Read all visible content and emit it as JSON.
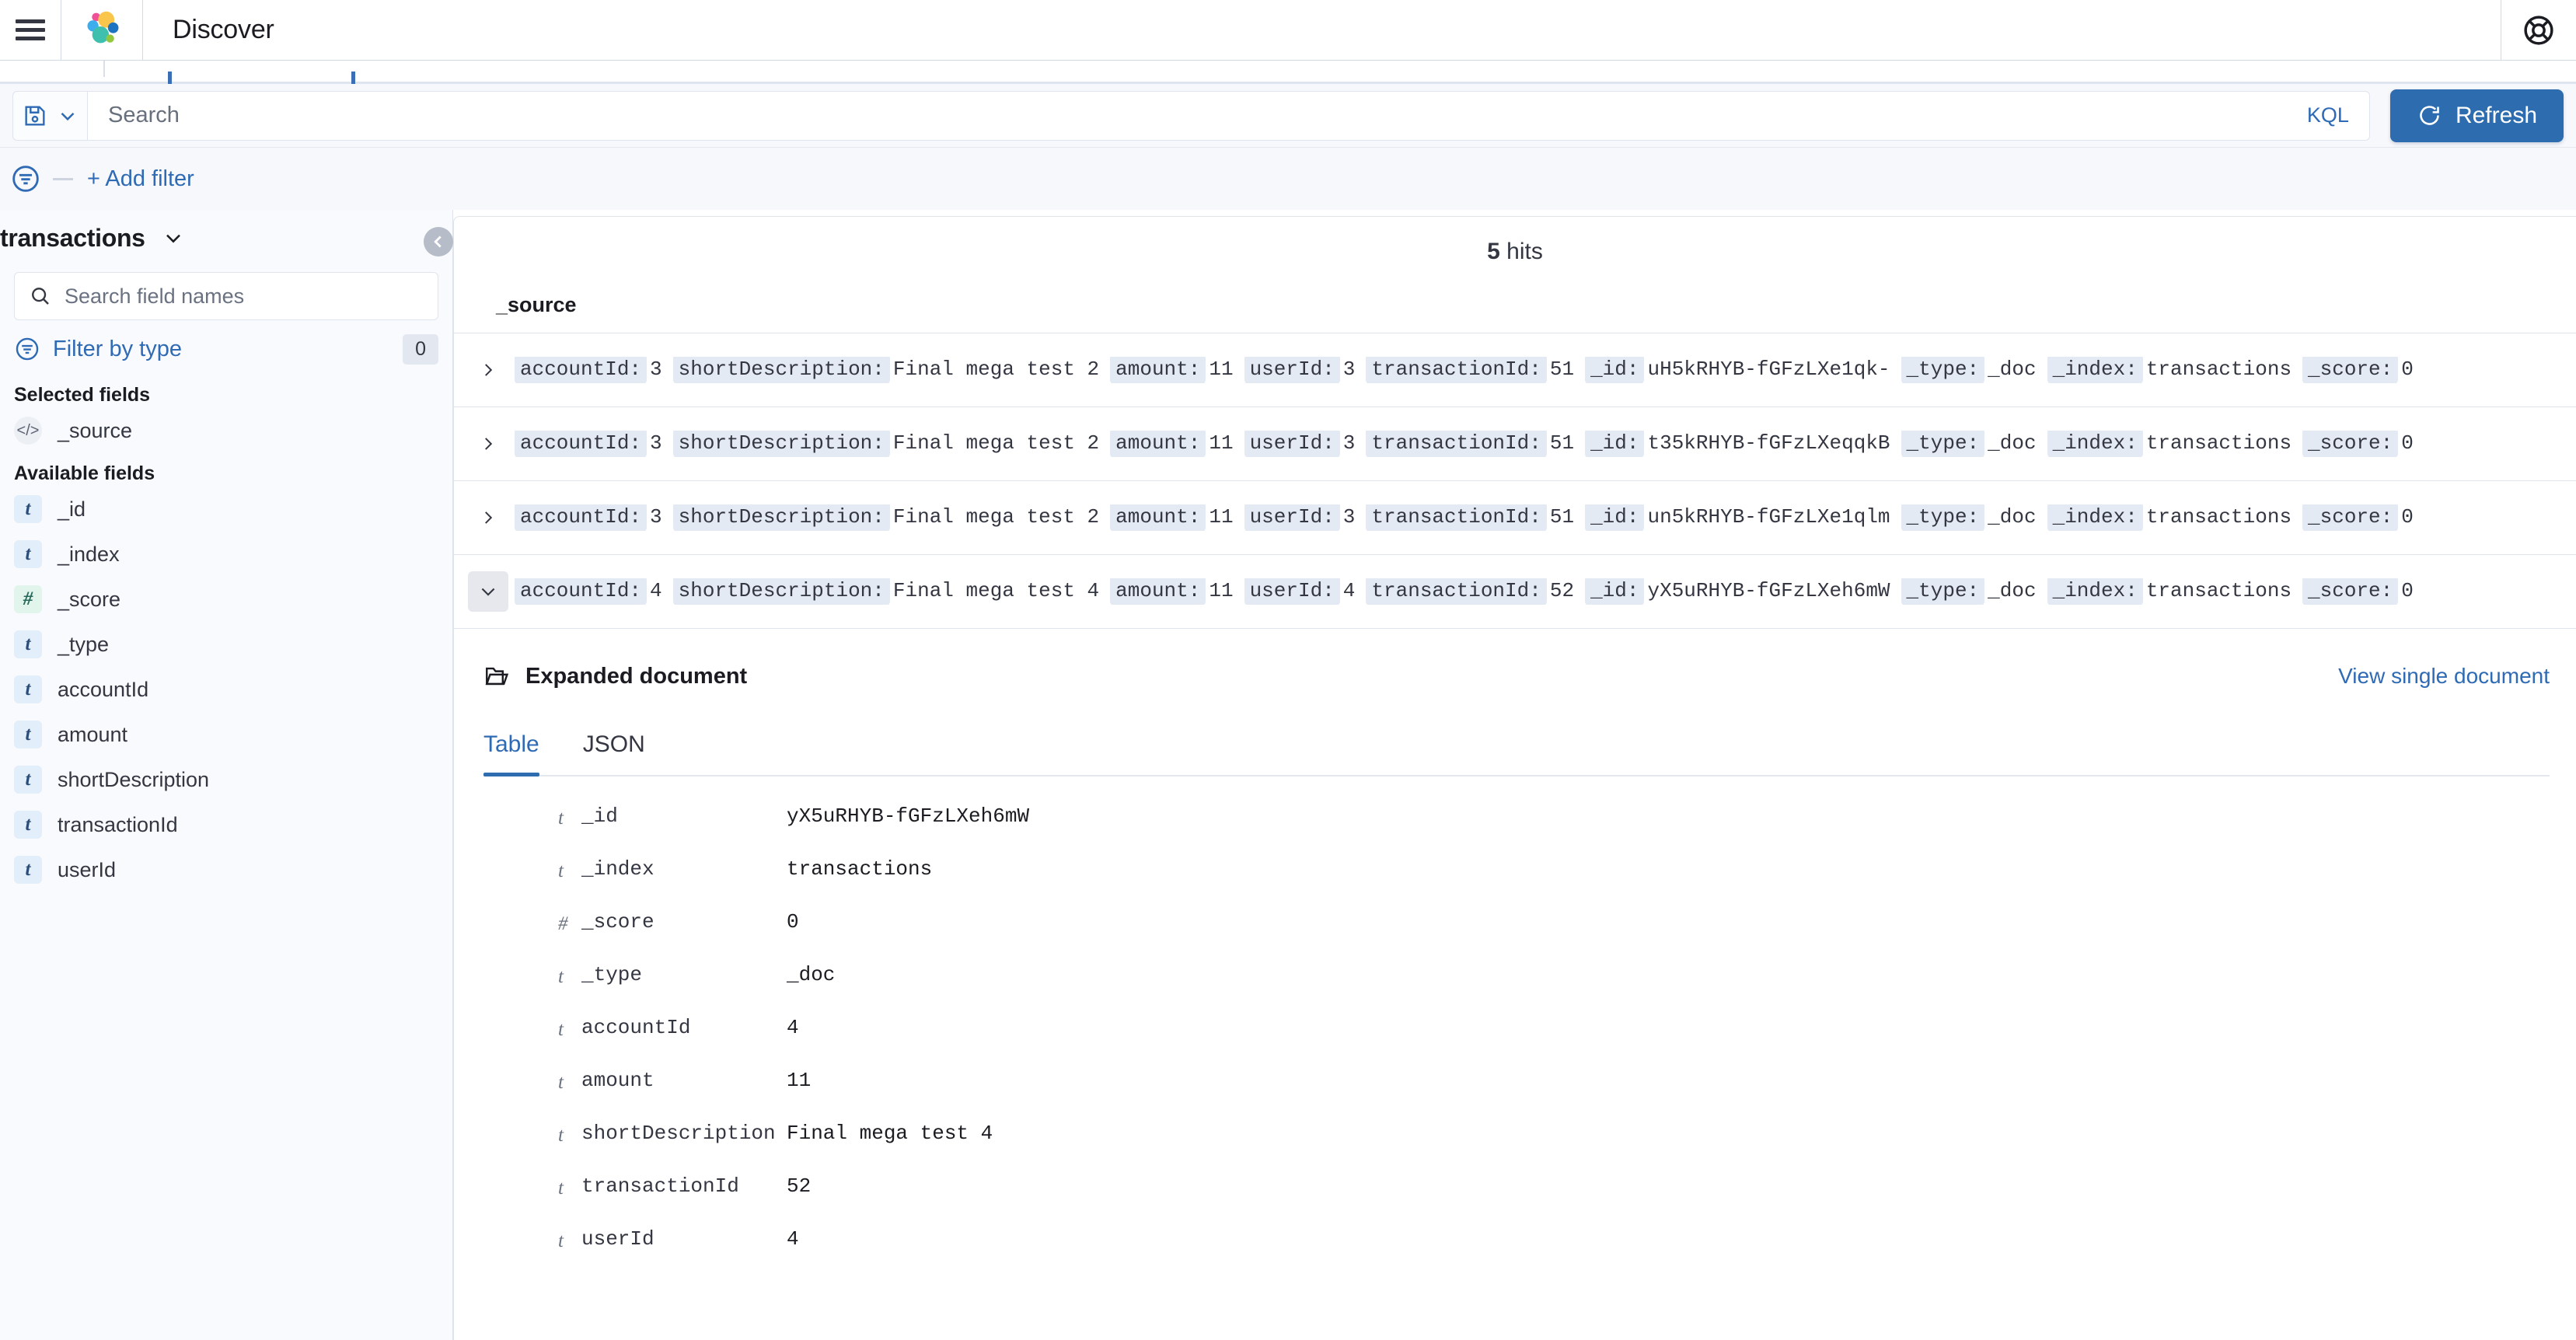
{
  "topnav": {
    "menu_icon": "hamburger-menu-icon",
    "logo_icon": "elastic-logo-icon",
    "title": "Discover",
    "help_icon": "help-lifebuoy-icon"
  },
  "querybar": {
    "saved_query_icon": "save-floppy-icon",
    "saved_query_chevron": "chevron-down-icon",
    "search_value": "",
    "search_placeholder": "Search",
    "language_label": "KQL",
    "refresh_icon": "refresh-icon",
    "refresh_label": "Refresh"
  },
  "filterbar": {
    "filter_icon": "filter-funnel-icon",
    "add_filter_label": "+ Add filter"
  },
  "sidebar": {
    "index_pattern": "transactions",
    "index_pattern_chevron": "chevron-down-icon",
    "field_search_value": "",
    "field_search_placeholder": "Search field names",
    "search_icon": "search-icon",
    "filter_by_type_icon": "filter-funnel-icon",
    "filter_by_type_label": "Filter by type",
    "filter_by_type_count": "0",
    "selected_fields_title": "Selected fields",
    "selected_fields": [
      {
        "name": "_source",
        "type": "source",
        "type_glyph": "</>"
      }
    ],
    "available_fields_title": "Available fields",
    "available_fields": [
      {
        "name": "_id",
        "type": "string",
        "type_glyph": "t"
      },
      {
        "name": "_index",
        "type": "string",
        "type_glyph": "t"
      },
      {
        "name": "_score",
        "type": "number",
        "type_glyph": "#"
      },
      {
        "name": "_type",
        "type": "string",
        "type_glyph": "t"
      },
      {
        "name": "accountId",
        "type": "string",
        "type_glyph": "t"
      },
      {
        "name": "amount",
        "type": "string",
        "type_glyph": "t"
      },
      {
        "name": "shortDescription",
        "type": "string",
        "type_glyph": "t"
      },
      {
        "name": "transactionId",
        "type": "string",
        "type_glyph": "t"
      },
      {
        "name": "userId",
        "type": "string",
        "type_glyph": "t"
      }
    ]
  },
  "main": {
    "collapse_icon": "chevron-left-icon",
    "hits_count": "5",
    "hits_label": "hits",
    "source_column_header": "_source",
    "rows": [
      {
        "expanded": false,
        "caret_icon": "chevron-right-icon",
        "pairs": [
          {
            "key": "accountId:",
            "value": "3"
          },
          {
            "key": "shortDescription:",
            "value": "Final mega test 2"
          },
          {
            "key": "amount:",
            "value": "11"
          },
          {
            "key": "userId:",
            "value": "3"
          },
          {
            "key": "transactionId:",
            "value": "51"
          },
          {
            "key": "_id:",
            "value": "uH5kRHYB-fGFzLXe1qk-"
          },
          {
            "key": "_type:",
            "value": "_doc"
          },
          {
            "key": "_index:",
            "value": "transactions"
          },
          {
            "key": "_score:",
            "value": "0"
          }
        ]
      },
      {
        "expanded": false,
        "caret_icon": "chevron-right-icon",
        "pairs": [
          {
            "key": "accountId:",
            "value": "3"
          },
          {
            "key": "shortDescription:",
            "value": "Final mega test 2"
          },
          {
            "key": "amount:",
            "value": "11"
          },
          {
            "key": "userId:",
            "value": "3"
          },
          {
            "key": "transactionId:",
            "value": "51"
          },
          {
            "key": "_id:",
            "value": "t35kRHYB-fGFzLXeqqkB"
          },
          {
            "key": "_type:",
            "value": "_doc"
          },
          {
            "key": "_index:",
            "value": "transactions"
          },
          {
            "key": "_score:",
            "value": "0"
          }
        ]
      },
      {
        "expanded": false,
        "caret_icon": "chevron-right-icon",
        "pairs": [
          {
            "key": "accountId:",
            "value": "3"
          },
          {
            "key": "shortDescription:",
            "value": "Final mega test 2"
          },
          {
            "key": "amount:",
            "value": "11"
          },
          {
            "key": "userId:",
            "value": "3"
          },
          {
            "key": "transactionId:",
            "value": "51"
          },
          {
            "key": "_id:",
            "value": "un5kRHYB-fGFzLXe1qlm"
          },
          {
            "key": "_type:",
            "value": "_doc"
          },
          {
            "key": "_index:",
            "value": "transactions"
          },
          {
            "key": "_score:",
            "value": "0"
          }
        ]
      },
      {
        "expanded": true,
        "caret_icon": "chevron-down-icon",
        "pairs": [
          {
            "key": "accountId:",
            "value": "4"
          },
          {
            "key": "shortDescription:",
            "value": "Final mega test 4"
          },
          {
            "key": "amount:",
            "value": "11"
          },
          {
            "key": "userId:",
            "value": "4"
          },
          {
            "key": "transactionId:",
            "value": "52"
          },
          {
            "key": "_id:",
            "value": "yX5uRHYB-fGFzLXeh6mW"
          },
          {
            "key": "_type:",
            "value": "_doc"
          },
          {
            "key": "_index:",
            "value": "transactions"
          },
          {
            "key": "_score:",
            "value": "0"
          }
        ]
      }
    ]
  },
  "expanded_document": {
    "folder_icon": "folder-open-icon",
    "title": "Expanded document",
    "view_single_label": "View single document",
    "tabs": [
      {
        "label": "Table",
        "active": true
      },
      {
        "label": "JSON",
        "active": false
      }
    ],
    "fields": [
      {
        "type_glyph": "t",
        "name": "_id",
        "value": "yX5uRHYB-fGFzLXeh6mW"
      },
      {
        "type_glyph": "t",
        "name": "_index",
        "value": "transactions"
      },
      {
        "type_glyph": "#",
        "name": "_score",
        "value": "0"
      },
      {
        "type_glyph": "t",
        "name": "_type",
        "value": "_doc"
      },
      {
        "type_glyph": "t",
        "name": "accountId",
        "value": "4"
      },
      {
        "type_glyph": "t",
        "name": "amount",
        "value": "11"
      },
      {
        "type_glyph": "t",
        "name": "shortDescription",
        "value": "Final mega test 4"
      },
      {
        "type_glyph": "t",
        "name": "transactionId",
        "value": "52"
      },
      {
        "type_glyph": "t",
        "name": "userId",
        "value": "4"
      }
    ]
  },
  "colors": {
    "accent_blue": "#2d6cae",
    "link_blue": "#2f6ab4",
    "text_dark": "#343741",
    "chip_bg": "#e4eaf4",
    "panel_border": "#dfe3ec",
    "bg_light": "#f7f8fc"
  }
}
